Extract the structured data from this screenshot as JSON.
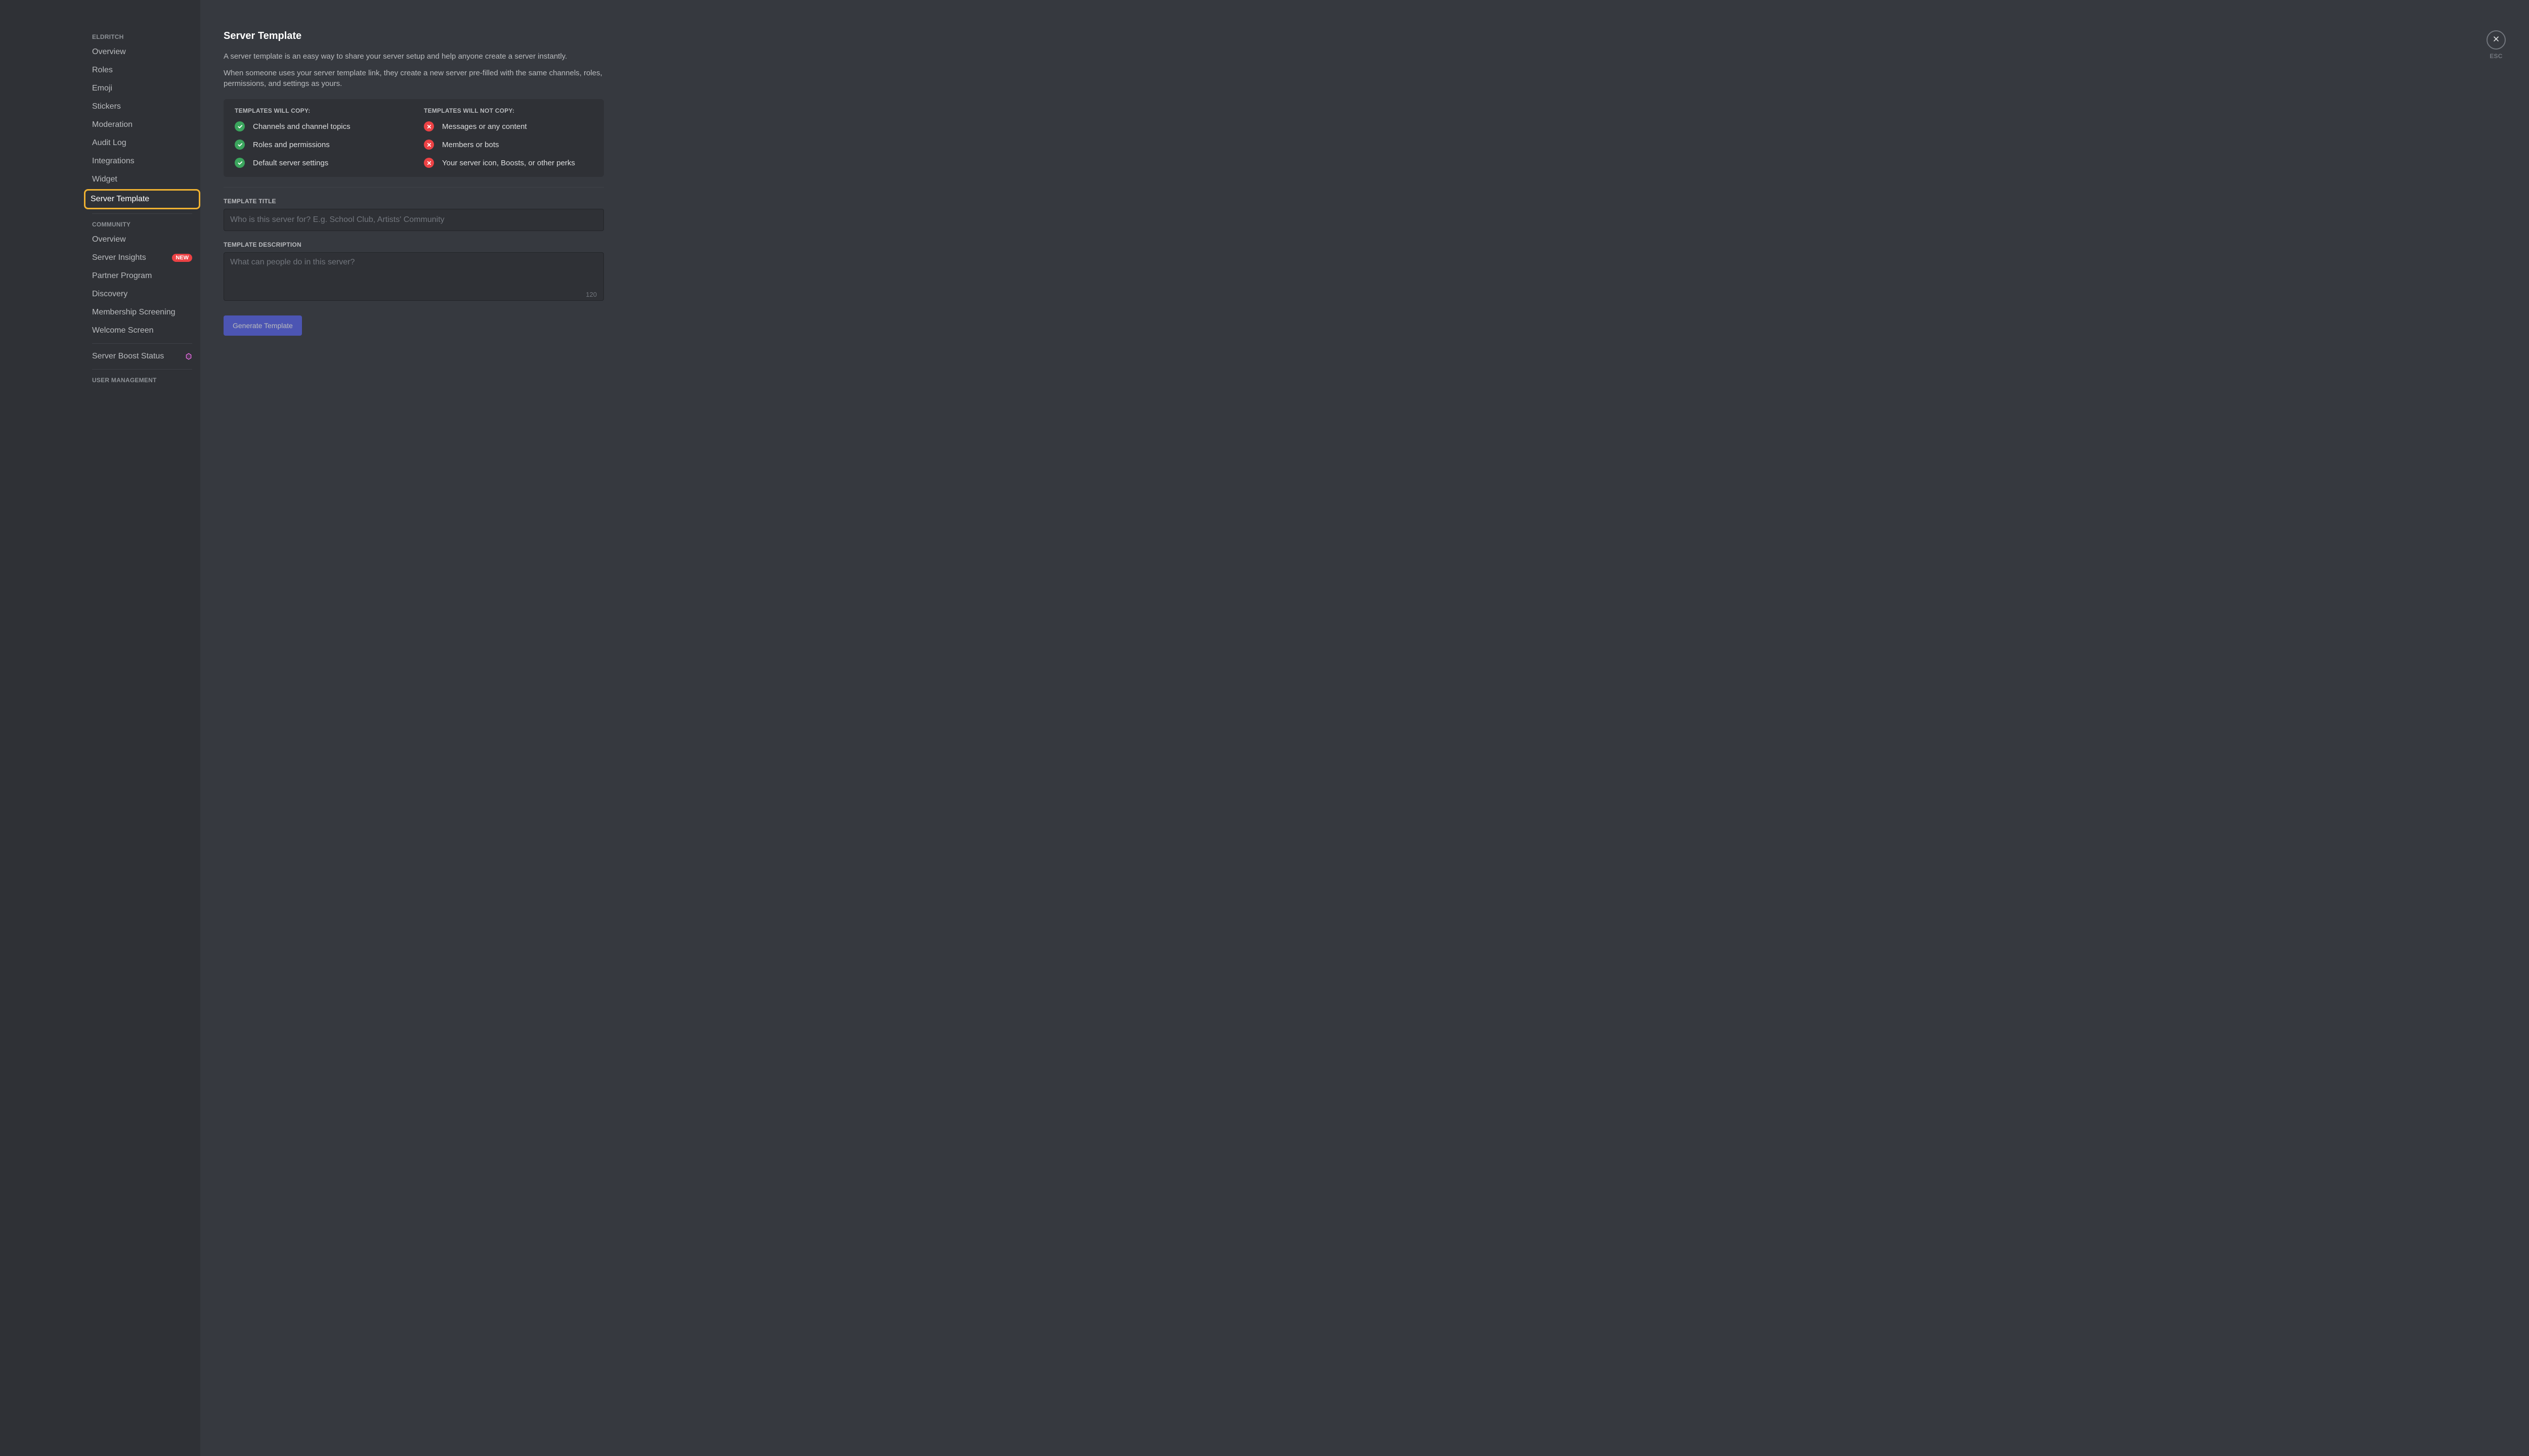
{
  "sidebar": {
    "section1_header": "Eldritch",
    "items1": [
      {
        "label": "Overview"
      },
      {
        "label": "Roles"
      },
      {
        "label": "Emoji"
      },
      {
        "label": "Stickers"
      },
      {
        "label": "Moderation"
      },
      {
        "label": "Audit Log"
      },
      {
        "label": "Integrations"
      },
      {
        "label": "Widget"
      },
      {
        "label": "Server Template",
        "active": true
      }
    ],
    "section2_header": "Community",
    "items2": [
      {
        "label": "Overview"
      },
      {
        "label": "Server Insights",
        "badge": "New"
      },
      {
        "label": "Partner Program"
      },
      {
        "label": "Discovery"
      },
      {
        "label": "Membership Screening"
      },
      {
        "label": "Welcome Screen"
      }
    ],
    "boost_label": "Server Boost Status",
    "section3_header": "User Management"
  },
  "main": {
    "title": "Server Template",
    "desc1": "A server template is an easy way to share your server setup and help anyone create a server instantly.",
    "desc2": "When someone uses your server template link, they create a new server pre-filled with the same channels, roles, permissions, and settings as yours.",
    "will_copy_header": "Templates will copy:",
    "will_copy": [
      "Channels and channel topics",
      "Roles and permissions",
      "Default server settings"
    ],
    "will_not_copy_header": "Templates will not copy:",
    "will_not_copy": [
      "Messages or any content",
      "Members or bots",
      "Your server icon, Boosts, or other perks"
    ],
    "title_label": "Template Title",
    "title_placeholder": "Who is this server for? E.g. School Club, Artists' Community",
    "title_value": "",
    "desc_label": "Template Description",
    "desc_placeholder": "What can people do in this server?",
    "desc_value": "",
    "char_count": "120",
    "generate_label": "Generate Template"
  },
  "close": {
    "esc": "ESC"
  }
}
